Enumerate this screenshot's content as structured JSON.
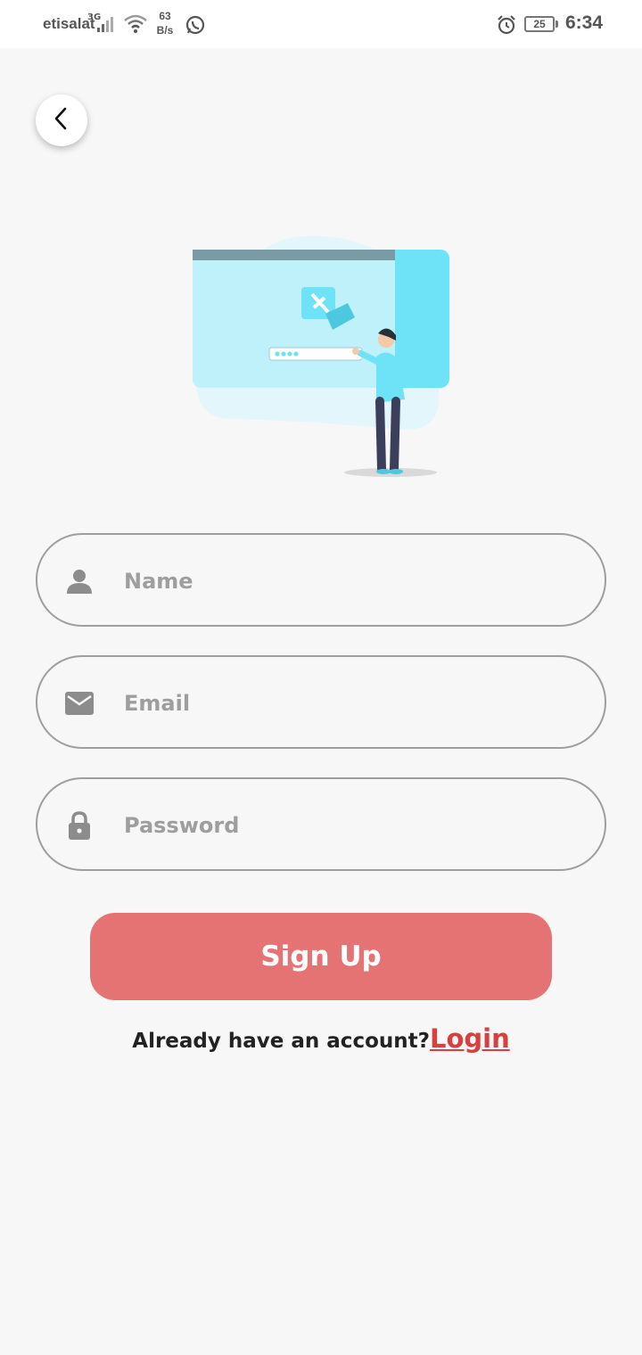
{
  "status_bar": {
    "carrier": "etisalat",
    "network_type": "3G",
    "speed_value": "63",
    "speed_unit": "B/s",
    "battery": "25",
    "time": "6:34"
  },
  "icons": {
    "back": "chevron-left-icon",
    "name_field": "person-icon",
    "email_field": "mail-icon",
    "password_field": "lock-icon"
  },
  "form": {
    "name_placeholder": "Name",
    "email_placeholder": "Email",
    "password_placeholder": "Password",
    "submit_label": "Sign Up"
  },
  "footer": {
    "prompt": "Already have an account?",
    "login_label": "Login"
  },
  "colors": {
    "primary_button": "#e57373",
    "login_link": "#d84040",
    "illustration_accent": "#6ee2f7"
  }
}
